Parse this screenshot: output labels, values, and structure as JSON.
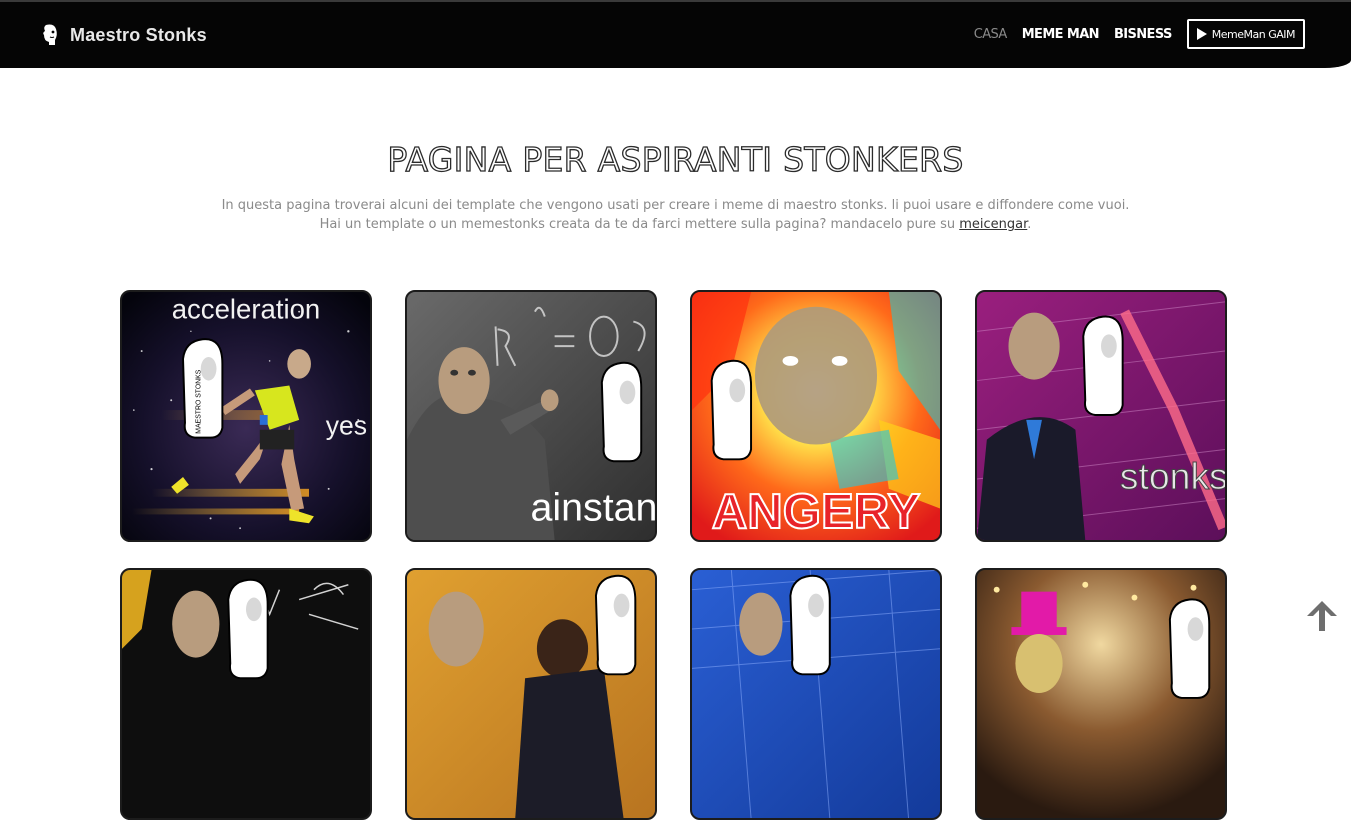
{
  "navbar": {
    "brand_name": "Maestro Stonks",
    "brand_icon": "meme-man-head-icon",
    "links": [
      {
        "label": "CASA",
        "active": true
      },
      {
        "label": "MEME MAN",
        "active": false
      },
      {
        "label": "BISNESS",
        "active": false
      }
    ],
    "cta_label": "MemeMan GAIM",
    "cta_icon": "play-icon"
  },
  "page": {
    "title": "PAGINA PER ASPIRANTI STONKERS",
    "intro_line1": "In questa pagina troverai alcuni dei template che vengono usati per creare i meme di maestro stonks. li puoi usare e diffondere come vuoi.",
    "intro_line2_before": "Hai un template o un memestonks creata da te da farci mettere sulla pagina? mandacelo pure su ",
    "intro_link": "meicengar",
    "intro_line2_after": "."
  },
  "gallery": {
    "cards": [
      {
        "caption_top": "acceleration",
        "caption_bottom": "yes"
      },
      {
        "caption_bottom": "ainstan"
      },
      {
        "caption_bottom": "ANGERY"
      },
      {
        "caption_bottom": "stonks"
      },
      {
        "caption_bottom": ""
      },
      {
        "caption_bottom": ""
      },
      {
        "caption_bottom": ""
      },
      {
        "caption_bottom": ""
      }
    ],
    "watermark": "MAESTRO STONKS"
  },
  "scroll_top_icon": "arrow-up-icon",
  "colors": {
    "navbar_bg": "#050505",
    "intro_text": "#8a8a8a",
    "card_border": "#1c1c1c"
  }
}
